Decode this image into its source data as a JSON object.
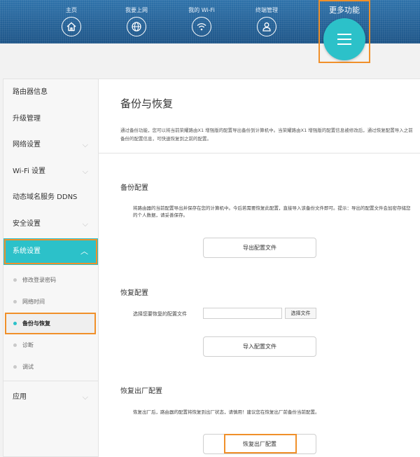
{
  "nav": {
    "items": [
      {
        "label": "主页",
        "icon": "home-icon"
      },
      {
        "label": "我要上网",
        "icon": "globe-icon"
      },
      {
        "label": "我的 Wi-Fi",
        "icon": "wifi-icon"
      },
      {
        "label": "终端管理",
        "icon": "user-icon"
      }
    ],
    "more_label": "更多功能",
    "more_icon": "menu-icon"
  },
  "sidebar": {
    "items": [
      {
        "label": "路由器信息"
      },
      {
        "label": "升级管理"
      },
      {
        "label": "网络设置"
      },
      {
        "label": "Wi-Fi 设置"
      },
      {
        "label": "动态域名服务 DDNS"
      },
      {
        "label": "安全设置"
      },
      {
        "label": "系统设置"
      },
      {
        "label": "应用"
      }
    ],
    "sub_items": [
      {
        "label": "修改登录密码"
      },
      {
        "label": "网络时间"
      },
      {
        "label": "备份与恢复"
      },
      {
        "label": "诊断"
      },
      {
        "label": "调试"
      }
    ],
    "chevron": "⌵"
  },
  "main": {
    "title": "备份与恢复",
    "description": "通过备份功能，您可以将当前荣耀路由X1 增强版的配置导出备份到计算机中。当荣耀路由X1 增强版的配置信息被修改后，通过恢复配置导入之前备份的配置信息，可快速恢复到之前的配置。",
    "backup": {
      "title": "备份配置",
      "text": "将路由器的当前配置导出并保存在您的计算机中。今后若需要恢复此配置，直接导入该备份文件即可。提示：导出的配置文件会加密存储您的个人数据，请妥善保存。",
      "button": "导出配置文件"
    },
    "restore": {
      "title": "恢复配置",
      "file_label": "选择您要恢复的配置文件",
      "file_value": "",
      "choose_button": "选择文件",
      "button": "导入配置文件"
    },
    "factory": {
      "title": "恢复出厂配置",
      "text": "恢复出厂后，路由器的配置将恢复到出厂状态，请慎用！建议您在恢复出厂前备份当前配置。",
      "button": "恢复出厂配置"
    }
  },
  "colors": {
    "accent": "#2cc1c9",
    "highlight": "#f0902a",
    "topbar": "#2466a0"
  }
}
